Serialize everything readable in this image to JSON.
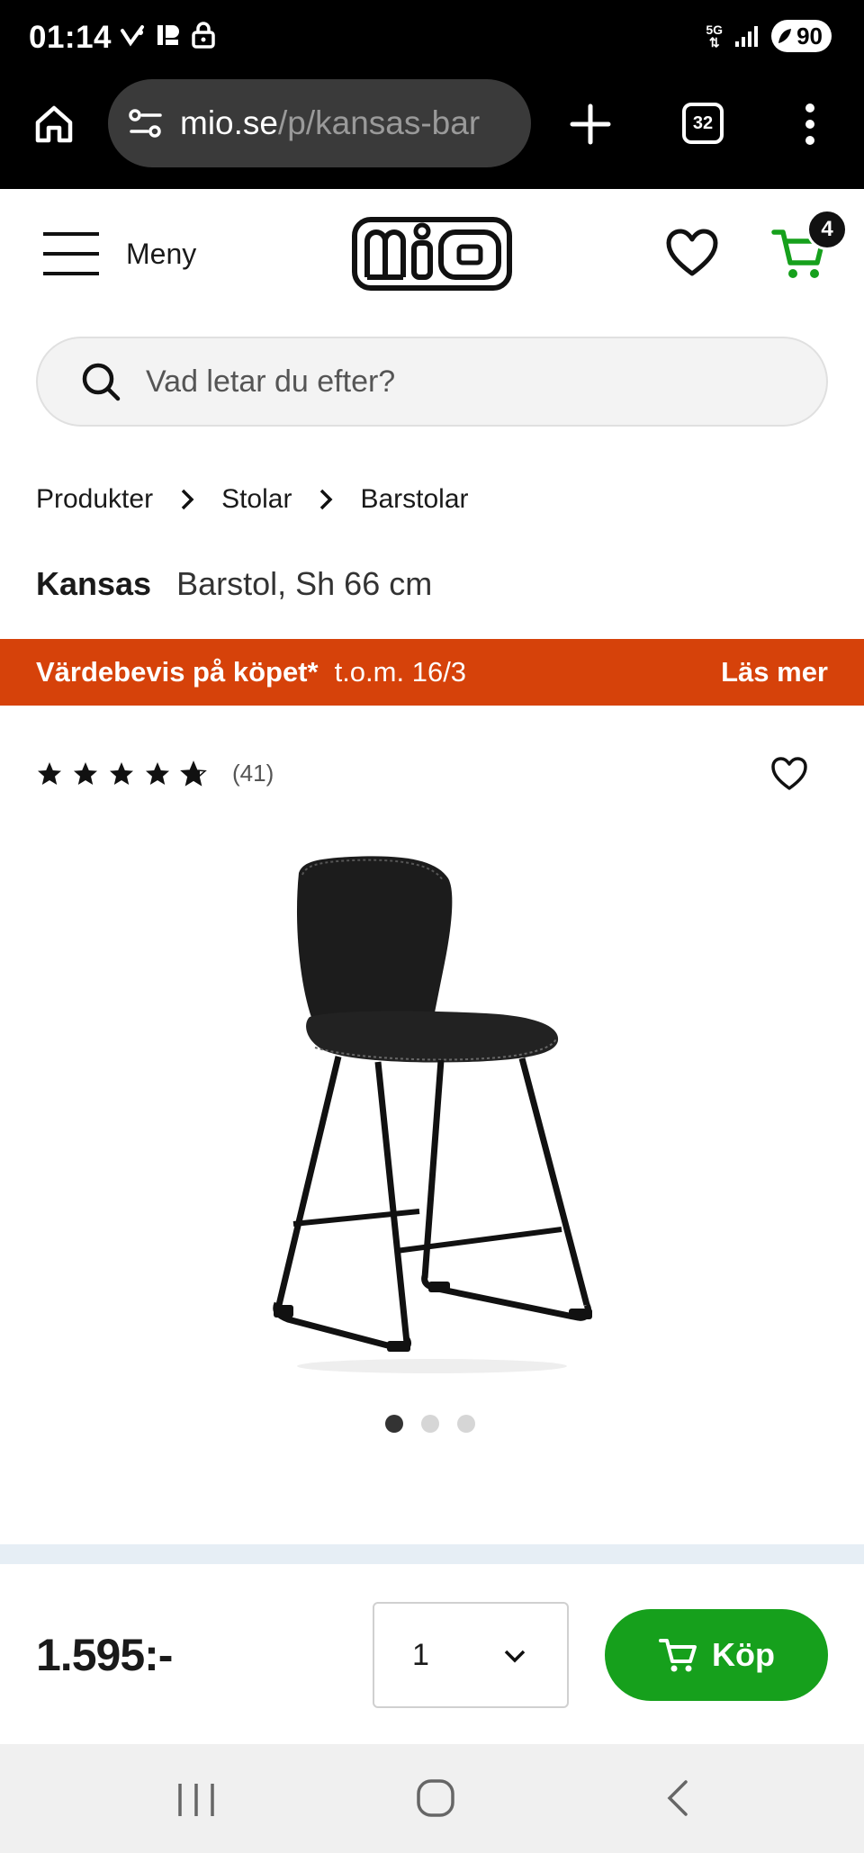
{
  "status_bar": {
    "time": "01:14",
    "network": "5G",
    "battery": "90"
  },
  "browser": {
    "url_host": "mio.se",
    "url_path": "/p/kansas-bar",
    "tab_count": "32"
  },
  "header": {
    "menu_label": "Meny",
    "logo_text": "MIO",
    "cart_count": "4"
  },
  "search": {
    "placeholder": "Vad letar du efter?"
  },
  "breadcrumb": [
    "Produkter",
    "Stolar",
    "Barstolar"
  ],
  "product": {
    "brand": "Kansas",
    "description": "Barstol, Sh 66 cm",
    "rating": 4.5,
    "rating_count": "(41)",
    "image_count": 3,
    "active_image": 1,
    "price": "1.595:-"
  },
  "promo": {
    "title": "Värdebevis på köpet*",
    "date": "t.o.m. 16/3",
    "link": "Läs mer"
  },
  "buy_bar": {
    "quantity": "1",
    "buy_label": "Köp"
  },
  "colors": {
    "promo": "#d6420a",
    "buy": "#16a01c",
    "cart_icon": "#16a01c"
  }
}
